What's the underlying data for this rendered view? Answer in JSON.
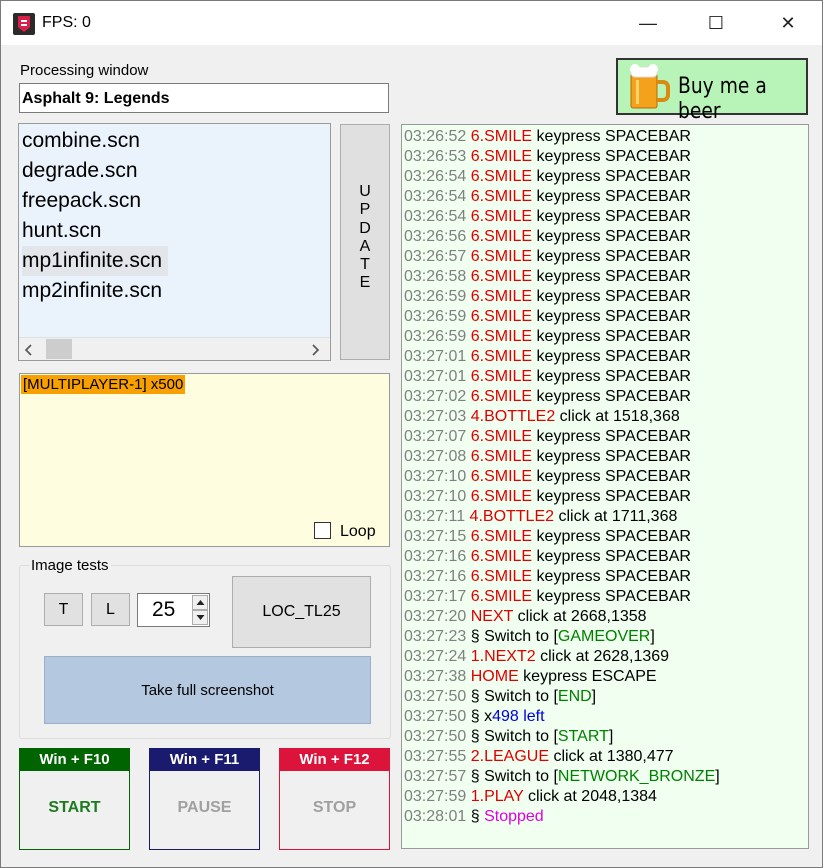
{
  "window": {
    "title": "FPS: 0"
  },
  "titlebar": {
    "minimize": "—",
    "maximize": "☐",
    "close": "✕"
  },
  "processing": {
    "label": "Processing window",
    "value": "Asphalt 9: Legends"
  },
  "beer_button": {
    "label": "Buy me a beer"
  },
  "files": [
    "combine.scn",
    "degrade.scn",
    "freepack.scn",
    "hunt.scn",
    "mp1infinite.scn",
    "mp2infinite.scn"
  ],
  "selected_file": "mp1infinite.scn",
  "update_button": {
    "letters": [
      "U",
      "P",
      "D",
      "A",
      "T",
      "E"
    ]
  },
  "scenario": {
    "item": "[MULTIPLAYER-1] x500",
    "loop_label": "Loop",
    "loop_checked": false
  },
  "image_tests": {
    "group_label": "Image tests",
    "t_label": "T",
    "l_label": "L",
    "spin_value": "25",
    "loc_label": "LOC_TL25",
    "screenshot_label": "Take full screenshot"
  },
  "controls": [
    {
      "hotkey": "Win + F10",
      "label": "START",
      "color": "#006400",
      "enabled": true
    },
    {
      "hotkey": "Win + F11",
      "label": "PAUSE",
      "color": "#1a1a6e",
      "enabled": false
    },
    {
      "hotkey": "Win + F12",
      "label": "STOP",
      "color": "#dc143c",
      "enabled": false
    }
  ],
  "colors": {
    "accent_green": "#b8f4b8",
    "log_bg": "#f0fff0",
    "list_bg": "#eaf3fc",
    "scenario_bg": "#fffde0",
    "scenario_sel": "#f7a000"
  },
  "log": [
    [
      [
        "03:26:52 ",
        "ts"
      ],
      [
        "6.SMILE",
        "red"
      ],
      [
        "  keypress SPACEBAR",
        "blk"
      ]
    ],
    [
      [
        "03:26:53 ",
        "ts"
      ],
      [
        "6.SMILE",
        "red"
      ],
      [
        "  keypress SPACEBAR",
        "blk"
      ]
    ],
    [
      [
        "03:26:54 ",
        "ts"
      ],
      [
        "6.SMILE",
        "red"
      ],
      [
        "  keypress SPACEBAR",
        "blk"
      ]
    ],
    [
      [
        "03:26:54 ",
        "ts"
      ],
      [
        "6.SMILE",
        "red"
      ],
      [
        "  keypress SPACEBAR",
        "blk"
      ]
    ],
    [
      [
        "03:26:54 ",
        "ts"
      ],
      [
        "6.SMILE",
        "red"
      ],
      [
        "  keypress SPACEBAR",
        "blk"
      ]
    ],
    [
      [
        "03:26:56 ",
        "ts"
      ],
      [
        "6.SMILE",
        "red"
      ],
      [
        "  keypress SPACEBAR",
        "blk"
      ]
    ],
    [
      [
        "03:26:57 ",
        "ts"
      ],
      [
        "6.SMILE",
        "red"
      ],
      [
        "  keypress SPACEBAR",
        "blk"
      ]
    ],
    [
      [
        "03:26:58 ",
        "ts"
      ],
      [
        "6.SMILE",
        "red"
      ],
      [
        "  keypress SPACEBAR",
        "blk"
      ]
    ],
    [
      [
        "03:26:59 ",
        "ts"
      ],
      [
        "6.SMILE",
        "red"
      ],
      [
        "  keypress SPACEBAR",
        "blk"
      ]
    ],
    [
      [
        "03:26:59 ",
        "ts"
      ],
      [
        "6.SMILE",
        "red"
      ],
      [
        "  keypress SPACEBAR",
        "blk"
      ]
    ],
    [
      [
        "03:26:59 ",
        "ts"
      ],
      [
        "6.SMILE",
        "red"
      ],
      [
        "  keypress SPACEBAR",
        "blk"
      ]
    ],
    [
      [
        "03:27:01 ",
        "ts"
      ],
      [
        "6.SMILE",
        "red"
      ],
      [
        "  keypress SPACEBAR",
        "blk"
      ]
    ],
    [
      [
        "03:27:01 ",
        "ts"
      ],
      [
        "6.SMILE",
        "red"
      ],
      [
        "  keypress SPACEBAR",
        "blk"
      ]
    ],
    [
      [
        "03:27:02 ",
        "ts"
      ],
      [
        "6.SMILE",
        "red"
      ],
      [
        "  keypress SPACEBAR",
        "blk"
      ]
    ],
    [
      [
        "03:27:03 ",
        "ts"
      ],
      [
        "4.BOTTLE2",
        "red"
      ],
      [
        "  click at 1518,368",
        "blk"
      ]
    ],
    [
      [
        "03:27:07 ",
        "ts"
      ],
      [
        "6.SMILE",
        "red"
      ],
      [
        "  keypress SPACEBAR",
        "blk"
      ]
    ],
    [
      [
        "03:27:08 ",
        "ts"
      ],
      [
        "6.SMILE",
        "red"
      ],
      [
        "  keypress SPACEBAR",
        "blk"
      ]
    ],
    [
      [
        "03:27:10 ",
        "ts"
      ],
      [
        "6.SMILE",
        "red"
      ],
      [
        "  keypress SPACEBAR",
        "blk"
      ]
    ],
    [
      [
        "03:27:10 ",
        "ts"
      ],
      [
        "6.SMILE",
        "red"
      ],
      [
        "  keypress SPACEBAR",
        "blk"
      ]
    ],
    [
      [
        "03:27:11 ",
        "ts"
      ],
      [
        "4.BOTTLE2",
        "red"
      ],
      [
        "  click at 1711,368",
        "blk"
      ]
    ],
    [
      [
        "03:27:15 ",
        "ts"
      ],
      [
        "6.SMILE",
        "red"
      ],
      [
        "  keypress SPACEBAR",
        "blk"
      ]
    ],
    [
      [
        "03:27:16 ",
        "ts"
      ],
      [
        "6.SMILE",
        "red"
      ],
      [
        "  keypress SPACEBAR",
        "blk"
      ]
    ],
    [
      [
        "03:27:16 ",
        "ts"
      ],
      [
        "6.SMILE",
        "red"
      ],
      [
        "  keypress SPACEBAR",
        "blk"
      ]
    ],
    [
      [
        "03:27:17 ",
        "ts"
      ],
      [
        "6.SMILE",
        "red"
      ],
      [
        "  keypress SPACEBAR",
        "blk"
      ]
    ],
    [
      [
        "03:27:20 ",
        "ts"
      ],
      [
        "NEXT",
        "red"
      ],
      [
        "  click at 2668,1358",
        "blk"
      ]
    ],
    [
      [
        "03:27:23 ",
        "ts"
      ],
      [
        "§ Switch to [",
        "blk"
      ],
      [
        "GAMEOVER",
        "green"
      ],
      [
        "]",
        "blk"
      ]
    ],
    [
      [
        "03:27:24 ",
        "ts"
      ],
      [
        "1.NEXT2",
        "red"
      ],
      [
        " click at 2628,1369",
        "blk"
      ]
    ],
    [
      [
        "03:27:38 ",
        "ts"
      ],
      [
        "HOME",
        "red"
      ],
      [
        "  keypress ESCAPE",
        "blk"
      ]
    ],
    [
      [
        "03:27:50 ",
        "ts"
      ],
      [
        "§ Switch to [",
        "blk"
      ],
      [
        "END",
        "green"
      ],
      [
        "]",
        "blk"
      ]
    ],
    [
      [
        "03:27:50 ",
        "ts"
      ],
      [
        "§ x",
        "blk"
      ],
      [
        "498 left",
        "blue"
      ]
    ],
    [
      [
        "03:27:50 ",
        "ts"
      ],
      [
        "§ Switch to [",
        "blk"
      ],
      [
        "START",
        "green"
      ],
      [
        "]",
        "blk"
      ]
    ],
    [
      [
        "03:27:55 ",
        "ts"
      ],
      [
        "2.LEAGUE",
        "red"
      ],
      [
        "  click at 1380,477",
        "blk"
      ]
    ],
    [
      [
        "03:27:57 ",
        "ts"
      ],
      [
        "§ Switch to [",
        "blk"
      ],
      [
        "NETWORK_BRONZE",
        "green"
      ],
      [
        "]",
        "blk"
      ]
    ],
    [
      [
        "03:27:59 ",
        "ts"
      ],
      [
        "1.PLAY",
        "red"
      ],
      [
        " click at 2048,1384",
        "blk"
      ]
    ],
    [
      [
        "03:28:01 ",
        "ts"
      ],
      [
        "§ ",
        "blk"
      ],
      [
        "Stopped",
        "mag"
      ]
    ]
  ]
}
